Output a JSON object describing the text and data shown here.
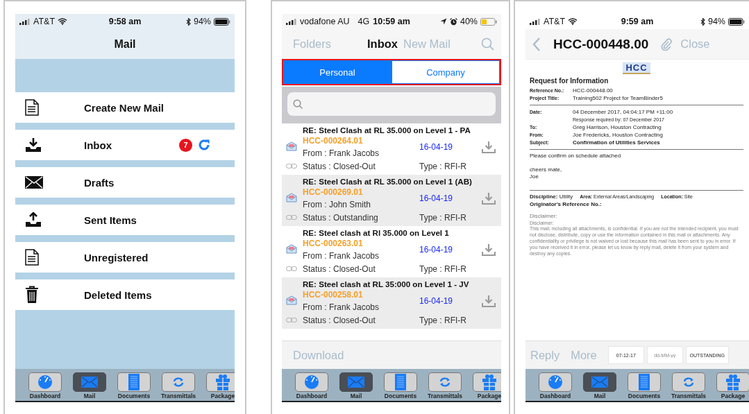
{
  "screens": [
    {
      "kind": "folders",
      "status_bar": {
        "carrier": "AT&T",
        "time": "9:58 am",
        "battery": "94%",
        "wifi": true,
        "bluetooth": true,
        "location": false,
        "alarm": false,
        "battery_low": false
      },
      "title": "Mail",
      "folders": [
        {
          "kind": "compose",
          "label": "Create New Mail"
        },
        {
          "kind": "inbox",
          "label": "Inbox",
          "badge": "7"
        },
        {
          "kind": "drafts",
          "label": "Drafts"
        },
        {
          "kind": "sent",
          "label": "Sent Items"
        },
        {
          "kind": "unregistered",
          "label": "Unregistered"
        },
        {
          "kind": "deleted",
          "label": "Deleted Items"
        }
      ],
      "tab_bar": [
        {
          "kind": "dashboard",
          "label": "Dashboard",
          "selected": false
        },
        {
          "kind": "mail",
          "label": "Mail",
          "selected": true
        },
        {
          "kind": "documents",
          "label": "Documents",
          "selected": false
        },
        {
          "kind": "transmittals",
          "label": "Transmittals",
          "selected": false
        },
        {
          "kind": "packages",
          "label": "Package",
          "selected": false
        }
      ]
    },
    {
      "kind": "inbox",
      "status_bar": {
        "carrier": "vodafone AU",
        "network": "4G",
        "time": "10:59 am",
        "battery": "40%",
        "wifi": false,
        "bluetooth": false,
        "location": true,
        "alarm": true,
        "battery_low": true
      },
      "nav": {
        "back": "Folders",
        "title": "Inbox",
        "action": "New Mail"
      },
      "segments": [
        {
          "label": "Personal",
          "selected": true
        },
        {
          "label": "Company",
          "selected": false
        }
      ],
      "messages": [
        {
          "subject": "RE: Steel Clash at RL 35.000 on Level 1 - PA",
          "reference": "HCC-000264.01",
          "from": "From : Frank Jacobs",
          "date": "16-04-19",
          "status": "Status : Closed-Out",
          "type": "Type : RFI-R"
        },
        {
          "subject": "RE: Steel Clash at RL 35.000 on Level 1 (AB)",
          "reference": "HCC-000269.01",
          "from": "From : John Smith",
          "date": "16-04-19",
          "status": "Status : Outstanding",
          "type": "Type : RFI-R"
        },
        {
          "subject": "RE: Steel clash at Rl 35.000 on Level 1",
          "reference": "HCC-000263.01",
          "from": "From : Frank Jacobs",
          "date": "16-04-19",
          "status": "Status : Closed-Out",
          "type": "Type : RFI-R"
        },
        {
          "subject": "RE: Steel clash at RL 35:000 on Level 1 - JV",
          "reference": "HCC-000258.01",
          "from": "From : Frank Jacobs",
          "date": "16-04-19",
          "status": "Status : Closed-Out",
          "type": "Type : RFI-R"
        }
      ],
      "footer_action": "Download",
      "tab_bar": [
        {
          "kind": "dashboard",
          "label": "Dashboard",
          "selected": false
        },
        {
          "kind": "mail",
          "label": "Mail",
          "selected": true
        },
        {
          "kind": "documents",
          "label": "Documents",
          "selected": false
        },
        {
          "kind": "transmittals",
          "label": "Transmittals",
          "selected": false
        },
        {
          "kind": "packages",
          "label": "Package",
          "selected": false
        }
      ]
    },
    {
      "kind": "document",
      "status_bar": {
        "carrier": "AT&T",
        "time": "9:59 am",
        "battery": "94%",
        "wifi": true,
        "bluetooth": true,
        "location": false,
        "alarm": false,
        "battery_low": false
      },
      "nav": {
        "title": "HCC-000448.00",
        "action": "Close"
      },
      "document": {
        "logo": "HCC",
        "heading": "Request for Information",
        "reference_fields": [
          {
            "label": "Reference No.:",
            "value": "HCC-000448.00"
          },
          {
            "label": "Project Title:",
            "value": "Training502 Project for TeamBinder5"
          }
        ],
        "detail_fields": [
          {
            "label": "Date:",
            "value": "04 December 2017, 04:04:17 PM +11:00",
            "note": "Response required by: 07 December 2017"
          },
          {
            "label": "To:",
            "value": "Greg Harrison, Houston Contracting"
          },
          {
            "label": "From:",
            "value": "Joe Fredericks, Houston Contracting"
          },
          {
            "label": "Subject:",
            "value": "Confirmation of Utilities Services",
            "emphasis": true
          }
        ],
        "body": [
          [
            "Please confirm on schedule attached"
          ],
          [
            "cheers mate,",
            "Joe"
          ]
        ],
        "discipline": "**Discipline:** Utility",
        "area": "**Area:** External Areas/Landscaping",
        "location": "**Location:** Site",
        "originator": "Originator's Reference No.:",
        "disclaimer_heading": "Disclaimer:",
        "disclaimer_label": "Disclaimer:",
        "disclaimer_text": "This mail, including all attachments, is confidential. If you are not the intended recipient, you must not disclose, distribute, copy or use the information contained in this mail or attachments. Any confidentiality or privilege is not waived or lost because this mail has been sent to you in error. If you have received it in error, please let us know by reply mail, delete it from your system and destroy any copies."
      },
      "actions": [
        "Reply",
        "More"
      ],
      "fields": [
        {
          "value": "07-12-17"
        },
        {
          "placeholder": "dd-MM-yy"
        },
        {
          "value": "OUTSTANDING"
        }
      ],
      "tab_bar": [
        {
          "kind": "dashboard",
          "label": "Dashboard",
          "selected": false
        },
        {
          "kind": "mail",
          "label": "Mail",
          "selected": true
        },
        {
          "kind": "documents",
          "label": "Documents",
          "selected": false
        },
        {
          "kind": "transmittals",
          "label": "Transmittals",
          "selected": false
        },
        {
          "kind": "packages",
          "label": "Package",
          "selected": false
        }
      ]
    }
  ]
}
